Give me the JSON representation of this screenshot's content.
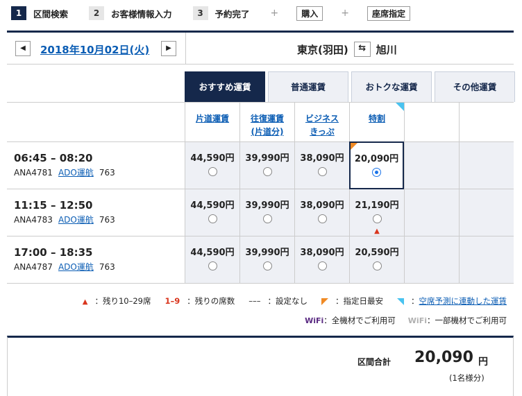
{
  "steps": [
    {
      "num": "1",
      "label": "区間検索",
      "active": true
    },
    {
      "num": "2",
      "label": "お客様情報入力",
      "active": false
    },
    {
      "num": "3",
      "label": "予約完了",
      "active": false
    }
  ],
  "plus_sign": "+",
  "options": {
    "purchase": "購入",
    "seat": "座席指定"
  },
  "date": {
    "text": "2018年10月02日(火)",
    "prev": "◀",
    "next": "▶"
  },
  "route": {
    "from": "東京(羽田)",
    "to": "旭川",
    "swap": "⇆"
  },
  "tabs": [
    {
      "label": "おすすめ運賃",
      "active": true
    },
    {
      "label": "普通運賃",
      "active": false
    },
    {
      "label": "おトクな運賃",
      "active": false
    },
    {
      "label": "その他運賃",
      "active": false
    }
  ],
  "fare_headers": [
    {
      "line1": "片道運賃",
      "line2": ""
    },
    {
      "line1": "往復運賃",
      "line2": "(片道分)"
    },
    {
      "line1": "ビジネス",
      "line2": "きっぷ"
    },
    {
      "line1": "特割",
      "line2": ""
    }
  ],
  "flights": [
    {
      "time": "06:45 – 08:20",
      "number": "ANA4781",
      "operator": "ADO運航",
      "aircraft": "763",
      "fares": [
        "44,590円",
        "39,990円",
        "38,090円",
        "20,090円"
      ],
      "selected": 3,
      "warning": ""
    },
    {
      "time": "11:15 – 12:50",
      "number": "ANA4783",
      "operator": "ADO運航",
      "aircraft": "763",
      "fares": [
        "44,590円",
        "39,990円",
        "38,090円",
        "21,190円"
      ],
      "selected": -1,
      "warning": "▲"
    },
    {
      "time": "17:00 – 18:35",
      "number": "ANA4787",
      "operator": "ADO運航",
      "aircraft": "763",
      "fares": [
        "44,590円",
        "39,990円",
        "38,090円",
        "20,590円"
      ],
      "selected": -1,
      "warning": ""
    }
  ],
  "legend": {
    "tri_symbol": "▲",
    "tri_text": "：残り10–29席",
    "red_symbol": "1–9",
    "red_text": "：残りの席数",
    "dash_symbol": "–––",
    "dash_text": "：設定なし",
    "orange_text": "：指定日最安",
    "cyan_link": "空席予測に連動した運賃",
    "cyan_prefix": "："
  },
  "wifi": {
    "on_label": "WiFi",
    "on_text": "：全機材でご利用可",
    "off_label": "WiFi",
    "off_text": "：一部機材でご利用可"
  },
  "total": {
    "label": "区間合計",
    "amount": "20,090",
    "unit": "円",
    "note": "(1名様分)"
  },
  "colors": {
    "navy": "#15284b",
    "link": "#0b5db4",
    "orange": "#f08a24",
    "cyan": "#49c3f0",
    "warn": "#d9361e"
  }
}
